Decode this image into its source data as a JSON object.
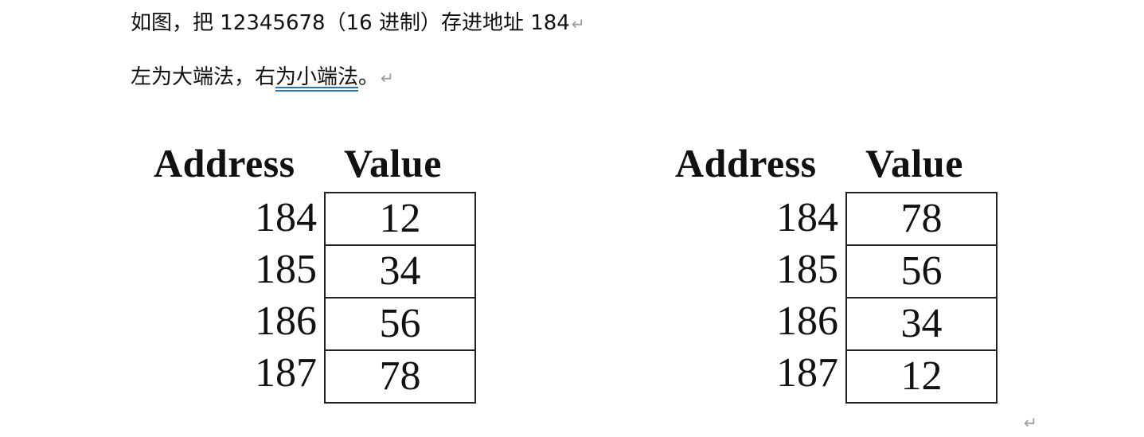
{
  "document": {
    "line1": "如图，把 12345678（16 进制）存进地址 184",
    "line2_prefix": "左为大端法，右",
    "line2_underlined": "为小端法",
    "line2_suffix": "。",
    "paragraph_mark": "↵"
  },
  "tables": [
    {
      "name": "big-endian",
      "header_address": "Address",
      "header_value": "Value",
      "rows": [
        {
          "address": "184",
          "value": "12"
        },
        {
          "address": "185",
          "value": "34"
        },
        {
          "address": "186",
          "value": "56"
        },
        {
          "address": "187",
          "value": "78"
        }
      ]
    },
    {
      "name": "little-endian",
      "header_address": "Address",
      "header_value": "Value",
      "rows": [
        {
          "address": "184",
          "value": "78"
        },
        {
          "address": "185",
          "value": "56"
        },
        {
          "address": "186",
          "value": "34"
        },
        {
          "address": "187",
          "value": "12"
        }
      ]
    }
  ],
  "colors": {
    "text": "#111111",
    "paragraph_mark": "#9a9a9a",
    "spellcheck_underline": "#2f6fb3",
    "table_border": "#222222"
  }
}
